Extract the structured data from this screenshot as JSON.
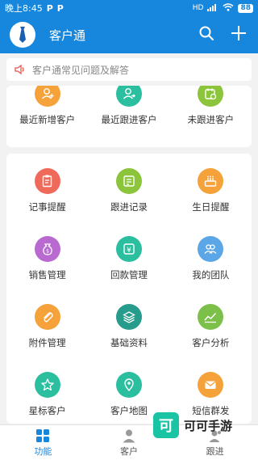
{
  "status": {
    "time": "晚上8:45",
    "p1": "P",
    "p2": "P",
    "signal": "HD",
    "battery": "88"
  },
  "header": {
    "title": "客户通"
  },
  "notice": {
    "text": "客户通常见问题及解答"
  },
  "top_items": [
    {
      "label": "最近新增客户",
      "icon": "person-add-icon",
      "color": "#f5a23a"
    },
    {
      "label": "最近跟进客户",
      "icon": "person-follow-icon",
      "color": "#2bbfa0"
    },
    {
      "label": "未跟进客户",
      "icon": "calendar-clock-icon",
      "color": "#8cc43c"
    }
  ],
  "items": [
    {
      "label": "记事提醒",
      "icon": "clipboard-icon",
      "color": "#ef6a5b"
    },
    {
      "label": "跟进记录",
      "icon": "record-icon",
      "color": "#8cc43c"
    },
    {
      "label": "生日提醒",
      "icon": "cake-icon",
      "color": "#f5a23a"
    },
    {
      "label": "销售管理",
      "icon": "money-bag-icon",
      "color": "#b86ad0"
    },
    {
      "label": "回款管理",
      "icon": "payment-icon",
      "color": "#2bbfa0"
    },
    {
      "label": "我的团队",
      "icon": "team-icon",
      "color": "#5aa6e6"
    },
    {
      "label": "附件管理",
      "icon": "paperclip-icon",
      "color": "#f5a23a"
    },
    {
      "label": "基础资料",
      "icon": "layers-icon",
      "color": "#279c8c"
    },
    {
      "label": "客户分析",
      "icon": "chart-icon",
      "color": "#8cc43c"
    },
    {
      "label": "星标客户",
      "icon": "star-icon",
      "color": "#2bbfa0"
    },
    {
      "label": "客户地图",
      "icon": "map-pin-icon",
      "color": "#2bbfa0"
    },
    {
      "label": "短信群发",
      "icon": "envelope-icon",
      "color": "#f5a23a"
    }
  ],
  "tabs": [
    {
      "label": "功能",
      "active": true
    },
    {
      "label": "客户",
      "active": false
    },
    {
      "label": "跟进",
      "active": false
    }
  ],
  "watermark": {
    "mark": "可",
    "text": "可可手游"
  }
}
